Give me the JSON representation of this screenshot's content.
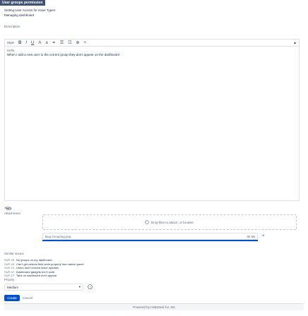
{
  "header": {
    "title": "User groups permission",
    "summary_line1": "Setting User Access for Issue Types",
    "summary_line2": "Managing dashboard"
  },
  "description": {
    "label": "Description",
    "toolbar": {
      "style": "Style",
      "bold": "B",
      "italic": "I",
      "underline": "U",
      "text_color": "A",
      "more_format": "a",
      "link": "⚭",
      "bullet_list": "☰",
      "numbered_list": "☷",
      "more": "⊕",
      "insert": "+",
      "collapse": "▴"
    },
    "lines": [
      "Hello,",
      "When I add a new user to the current group they don't appear on the dashboard"
    ]
  },
  "attachment": {
    "paperclip_icon": "paperclip-icon",
    "label": "Attachment",
    "dropzone_text": "Drop files to attach, or browse.",
    "file_name": "Bug Grouping.png",
    "file_size": "85 kB",
    "progress": 1.0,
    "close_glyph": "×"
  },
  "similar": {
    "label": "Similar issues",
    "items": [
      {
        "key": "SUP-25",
        "summary": "No groups on my dashboard"
      },
      {
        "key": "SUP-49",
        "summary": "Can't get custom field work properly from admin panel"
      },
      {
        "key": "SUP-24",
        "summary": "Users don't receive issue updates"
      },
      {
        "key": "SUP-37",
        "summary": "Dashboard gadgets don't work"
      },
      {
        "key": "SUP-27",
        "summary": "Tabs on dashboard don't appear"
      }
    ]
  },
  "priority": {
    "label": "Priority",
    "value": "Medium",
    "chevron": "▾",
    "help_glyph": "?"
  },
  "actions": {
    "create_label": "Create",
    "cancel_label": "Cancel"
  },
  "footer": {
    "text": "Powered by HelpDesk for Jira"
  },
  "colors": {
    "primary": "#0052cc",
    "title_bg": "#42526e",
    "border": "#dfe1e6"
  }
}
